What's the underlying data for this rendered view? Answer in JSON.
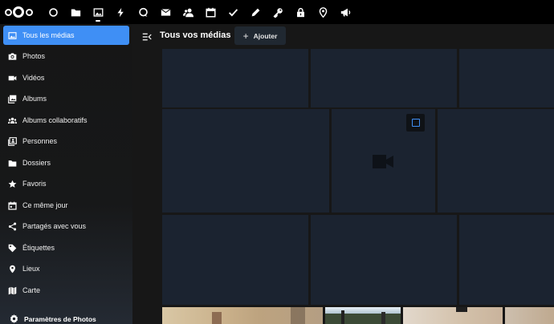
{
  "topbar": {
    "apps": [
      {
        "icon": "dashboard-icon",
        "active": false
      },
      {
        "icon": "folder-icon",
        "active": false
      },
      {
        "icon": "image-icon",
        "active": true
      },
      {
        "icon": "lightning-icon",
        "active": false
      },
      {
        "icon": "talk-icon",
        "active": false
      },
      {
        "icon": "mail-icon",
        "active": false
      },
      {
        "icon": "contacts-icon",
        "active": false
      },
      {
        "icon": "calendar-icon",
        "active": false
      },
      {
        "icon": "check-icon",
        "active": false
      },
      {
        "icon": "pencil-icon",
        "active": false
      },
      {
        "icon": "key-icon",
        "active": false
      },
      {
        "icon": "lock-icon",
        "active": false
      },
      {
        "icon": "map-pin-icon",
        "active": false
      },
      {
        "icon": "megaphone-icon",
        "active": false
      }
    ]
  },
  "sidebar": {
    "items": [
      {
        "label": "Tous les médias",
        "icon": "image-icon",
        "active": true
      },
      {
        "label": "Photos",
        "icon": "camera-icon",
        "active": false
      },
      {
        "label": "Vidéos",
        "icon": "video-icon",
        "active": false
      },
      {
        "label": "Albums",
        "icon": "album-icon",
        "active": false
      },
      {
        "label": "Albums collaboratifs",
        "icon": "group-icon",
        "active": false
      },
      {
        "label": "Personnes",
        "icon": "people-icon",
        "active": false
      },
      {
        "label": "Dossiers",
        "icon": "folder-icon",
        "active": false
      },
      {
        "label": "Favoris",
        "icon": "star-icon",
        "active": false
      },
      {
        "label": "Ce même jour",
        "icon": "calendar-icon",
        "active": false
      },
      {
        "label": "Partagés avec vous",
        "icon": "share-icon",
        "active": false
      },
      {
        "label": "Étiquettes",
        "icon": "tag-icon",
        "active": false
      },
      {
        "label": "Lieux",
        "icon": "map-pin-icon",
        "active": false
      },
      {
        "label": "Carte",
        "icon": "map-icon",
        "active": false
      }
    ],
    "settings_label": "Paramètres de Photos"
  },
  "header": {
    "title": "Tous vos médias",
    "add_label": "Ajouter"
  },
  "colors": {
    "accent": "#3f8ff5",
    "tile": "#1b2330",
    "button": "#202831"
  }
}
